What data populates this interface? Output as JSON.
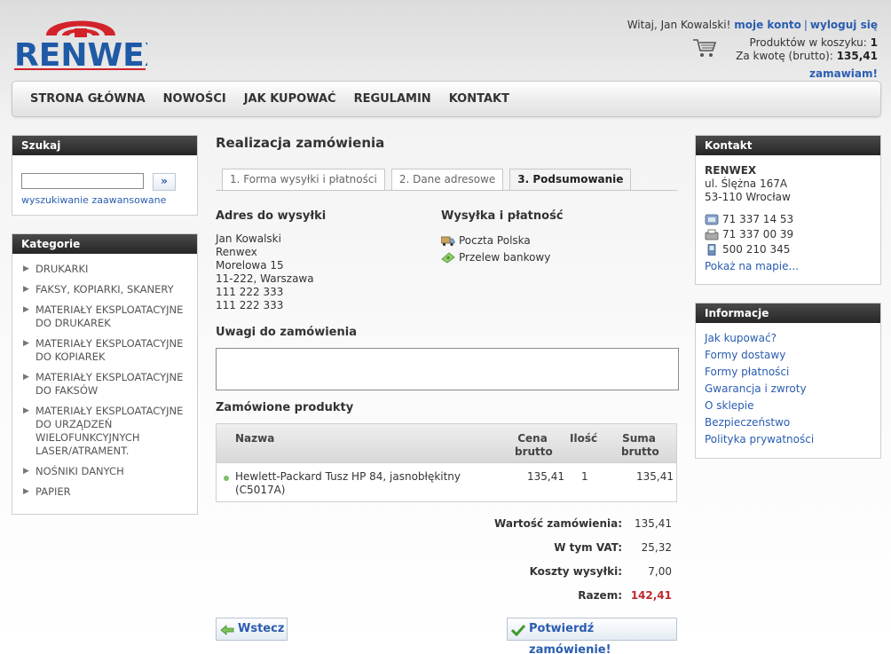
{
  "header": {
    "brand": "RENWEX",
    "welcome_prefix": "Witaj, Jan Kowalski!",
    "my_account": "moje konto",
    "separator": "|",
    "logout": "wyloguj się",
    "cart_count_label": "Produktów w koszyku:",
    "cart_count": "1",
    "cart_total_label": "Za kwotę (brutto):",
    "cart_total": "135,41",
    "order_now": "zamawiam!"
  },
  "nav": {
    "items": [
      "STRONA GŁÓWNA",
      "NOWOŚCI",
      "JAK KUPOWAĆ",
      "REGULAMIN",
      "KONTAKT"
    ]
  },
  "search": {
    "title": "Szukaj",
    "button": "»",
    "advanced": "wyszukiwanie zaawansowane"
  },
  "categories": {
    "title": "Kategorie",
    "items": [
      [
        "DRUKARKI"
      ],
      [
        "FAKSY, KOPIARKI, SKANERY"
      ],
      [
        "MATERIAŁY EKSPLOATACYJNE",
        "DO DRUKAREK"
      ],
      [
        "MATERIAŁY EKSPLOATACYJNE",
        "DO KOPIAREK"
      ],
      [
        "MATERIAŁY EKSPLOATACYJNE",
        "DO FAKSÓW"
      ],
      [
        "MATERIAŁY EKSPLOATACYJNE",
        "DO URZĄDZEŃ",
        "WIELOFUNKCYJNYCH",
        "LASER/ATRAMENT."
      ],
      [
        "NOŚNIKI DANYCH"
      ],
      [
        "PAPIER"
      ]
    ]
  },
  "main": {
    "title": "Realizacja zamówienia",
    "steps": [
      "1. Forma wysyłki i płatności",
      "2. Dane adresowe",
      "3. Podsumowanie"
    ],
    "shipping_address_heading": "Adres do wysyłki",
    "address_lines": [
      "Jan Kowalski",
      "Renwex",
      "Morelowa 15",
      "11-222, Warszawa",
      "111 222 333",
      "111 222 333"
    ],
    "shipping_payment_heading": "Wysyłka i płatność",
    "shipping_method": "Poczta Polska",
    "payment_method": "Przelew bankowy",
    "notes_heading": "Uwagi do zamówienia",
    "notes_value": "",
    "products_heading": "Zamówione produkty",
    "table": {
      "col_name": "Nazwa",
      "col_price": [
        "Cena",
        "brutto"
      ],
      "col_qty": "Ilość",
      "col_sum": [
        "Suma",
        "brutto"
      ],
      "rows": [
        {
          "name": [
            "Hewlett-Packard Tusz HP 84, jasnobłękitny",
            "(C5017A)"
          ],
          "price": "135,41",
          "qty": "1",
          "sum": "135,41"
        }
      ]
    },
    "totals": [
      {
        "label": "Wartość zamówienia:",
        "value": "135,41"
      },
      {
        "label": "W tym VAT:",
        "value": "25,32"
      },
      {
        "label": "Koszty wysyłki:",
        "value": "7,00"
      },
      {
        "label": "Razem:",
        "value": "142,41"
      }
    ],
    "back_button": "Wstecz",
    "confirm_button": "Potwierdź zamówienie!"
  },
  "contact": {
    "title": "Kontakt",
    "name": "RENWEX",
    "street": "ul. Ślężna 167A",
    "city": "53-110 Wrocław",
    "phone1": "71 337 14 53",
    "fax": "71 337 00 39",
    "mobile": "500 210 345",
    "map_link": "Pokaż na mapie..."
  },
  "info": {
    "title": "Informacje",
    "links": [
      "Jak kupować?",
      "Formy dostawy",
      "Formy płatności",
      "Gwarancja i zwroty",
      "O sklepie",
      "Bezpieczeństwo",
      "Polityka prywatności"
    ]
  },
  "colors": {
    "brand_blue": "#1f5aa6",
    "brand_red": "#d2232a",
    "link": "#2a5db0",
    "total_red": "#c0282d"
  }
}
